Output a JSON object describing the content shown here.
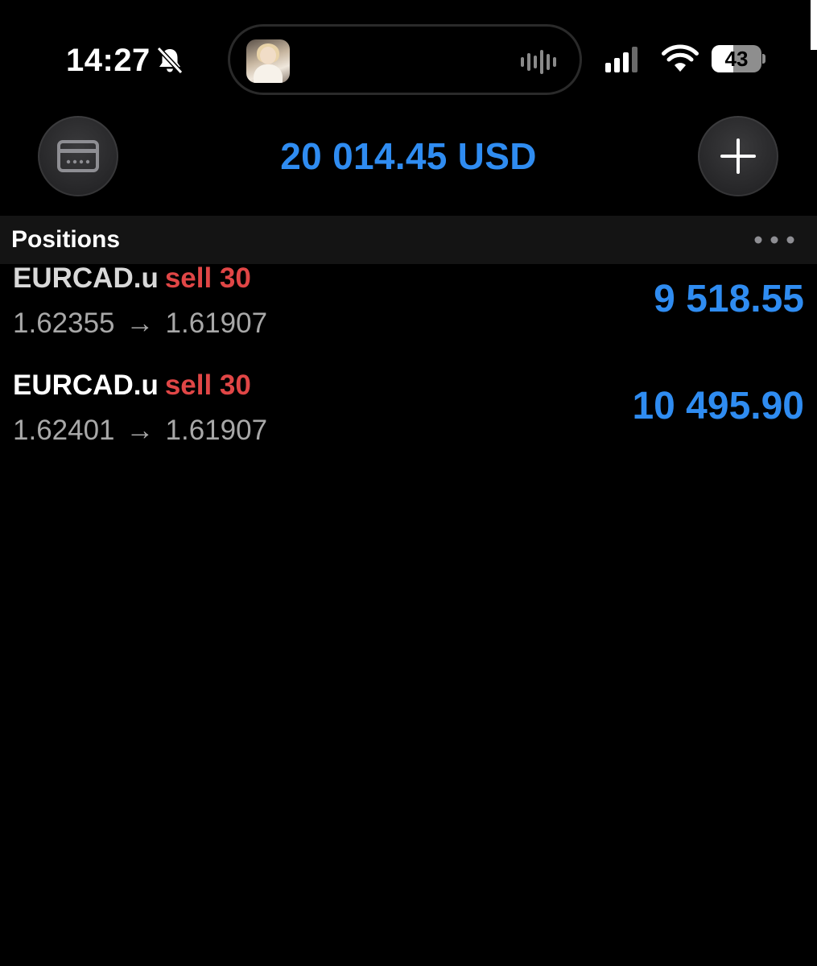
{
  "status_bar": {
    "time": "14:27",
    "battery": "43",
    "battery_level": 0.43,
    "icons": [
      "bell-slash-icon",
      "waveform-icon",
      "cellular-signal-icon",
      "wifi-icon",
      "battery-icon"
    ]
  },
  "header": {
    "balance": "20 014.45 USD",
    "left_button_icon": "wallet-card-icon",
    "right_button_icon": "plus-icon"
  },
  "positions": {
    "title": "Positions",
    "more_icon": "ellipsis-icon",
    "items": [
      {
        "symbol": "EURCAD.u",
        "side": "sell 30",
        "open_price": "1.62355",
        "arrow": "→",
        "current_price": "1.61907",
        "profit": "9 518.55"
      },
      {
        "symbol": "EURCAD.u",
        "side": "sell 30",
        "open_price": "1.62401",
        "arrow": "→",
        "current_price": "1.61907",
        "profit": "10 495.90"
      }
    ]
  },
  "colors": {
    "accent_blue": "#2f8cf1",
    "sell_red": "#e04646",
    "background": "#000000"
  }
}
